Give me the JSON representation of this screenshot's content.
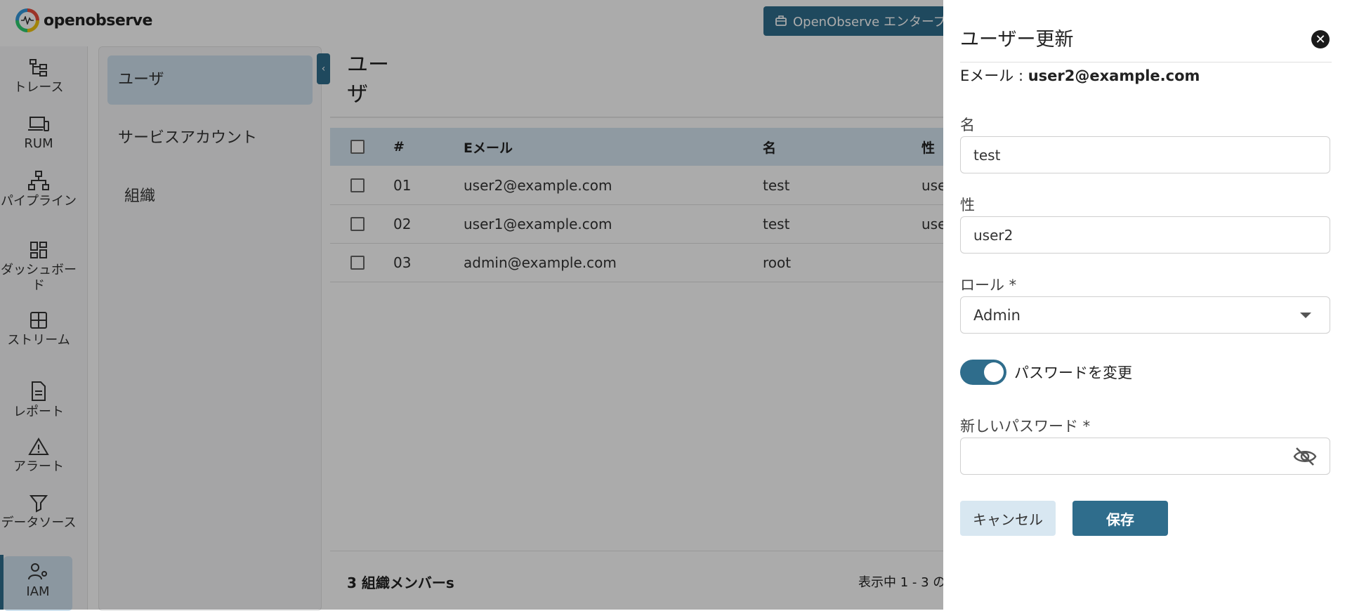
{
  "header": {
    "brand": "openobserve",
    "enterprise_button": "OpenObserve エンタープライ"
  },
  "nav": {
    "items": [
      {
        "label": "トレース",
        "icon": "traces-icon"
      },
      {
        "label": "RUM",
        "icon": "devices-icon"
      },
      {
        "label": "パイプライン",
        "icon": "pipeline-icon"
      },
      {
        "label": "ダッシュボード",
        "icon": "dashboard-icon"
      },
      {
        "label": "ストリーム",
        "icon": "streams-icon"
      },
      {
        "label": "レポート",
        "icon": "report-icon"
      },
      {
        "label": "アラート",
        "icon": "alert-icon"
      },
      {
        "label": "データソース",
        "icon": "filter-icon"
      },
      {
        "label": "IAM",
        "icon": "iam-icon"
      }
    ]
  },
  "submenu": {
    "items": [
      {
        "label": "ユーザ"
      },
      {
        "label": "サービスアカウント"
      },
      {
        "label": "組織"
      }
    ]
  },
  "main": {
    "title": "ユーザ",
    "table": {
      "columns": [
        "#",
        "Eメール",
        "名",
        "性"
      ],
      "rows": [
        {
          "num": "01",
          "email": "user2@example.com",
          "first": "test",
          "last": "use"
        },
        {
          "num": "02",
          "email": "user1@example.com",
          "first": "test",
          "last": "use"
        },
        {
          "num": "03",
          "email": "admin@example.com",
          "first": "root",
          "last": ""
        }
      ]
    },
    "footer": {
      "count": "3 組織メンバーs",
      "range": "表示中 1 - 3 の"
    }
  },
  "drawer": {
    "title": "ユーザー更新",
    "email_label": "Eメール : ",
    "email_value": "user2@example.com",
    "first_name_label": "名",
    "first_name_value": "test",
    "last_name_label": "性",
    "last_name_value": "user2",
    "role_label": "ロール *",
    "role_value": "Admin",
    "toggle_label": "パスワードを変更",
    "toggle_on": true,
    "new_password_label": "新しいパスワード *",
    "new_password_value": "",
    "cancel_label": "キャンセル",
    "save_label": "保存"
  },
  "colors": {
    "accent": "#2f6d8c",
    "selected_bg": "#cfe2ef",
    "table_header_bg": "#d5e6f2"
  }
}
